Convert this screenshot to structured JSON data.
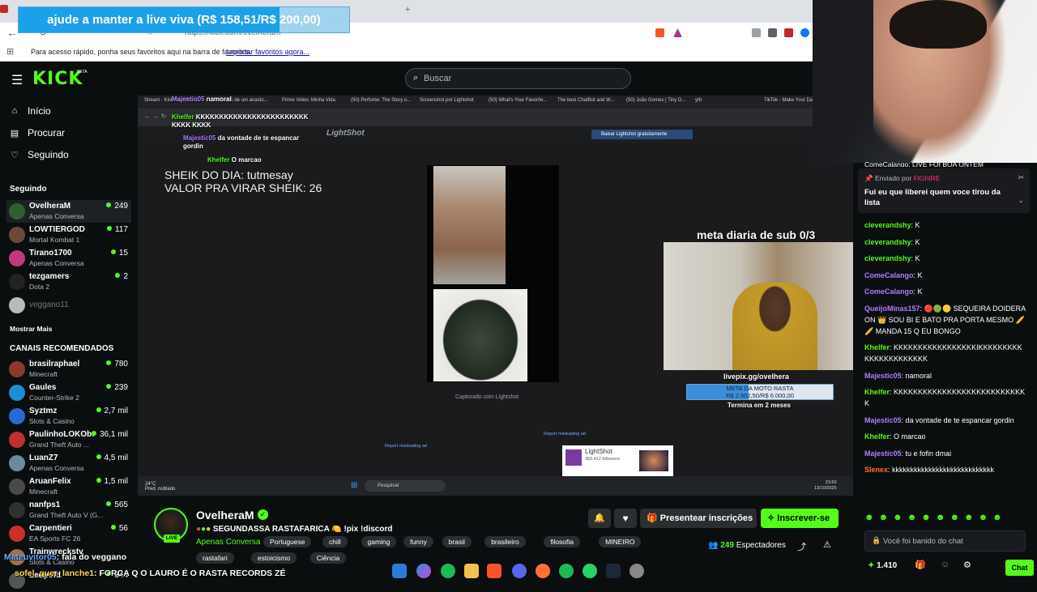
{
  "browser": {
    "donation_text": "ajude a manter a live viva (R$ 158,51/R$ 200,00)",
    "donation_progress": 0.79,
    "url": "https://kick.com/ovelheram",
    "bookmark_hint": "Para acesso rápido, ponha seus favoritos aqui na barra de favoritos.",
    "bookmark_link": "Importar favoritos agora..."
  },
  "header": {
    "logo": "KICK",
    "logo_badge": "BETA",
    "search_placeholder": "Buscar"
  },
  "sidebar": {
    "nav": [
      {
        "label": "Início",
        "icon": "home-icon"
      },
      {
        "label": "Procurar",
        "icon": "browse-icon"
      },
      {
        "label": "Seguindo",
        "icon": "heart-icon"
      }
    ],
    "following_title": "Seguindo",
    "following": [
      {
        "name": "OvelheraM",
        "category": "Apenas Conversa",
        "viewers": "249",
        "color": "#2f5f2f"
      },
      {
        "name": "LOWTIERGOD",
        "category": "Mortal Kombat 1",
        "viewers": "117",
        "color": "#6b4a3a"
      },
      {
        "name": "Tirano1700",
        "category": "Apenas Conversa",
        "viewers": "15",
        "color": "#c0397a"
      },
      {
        "name": "tezgamers",
        "category": "Dota 2",
        "viewers": "2",
        "color": "#222222"
      },
      {
        "name": "veggano11",
        "category": "",
        "viewers": "",
        "color": "#bbbbbb"
      }
    ],
    "show_more": "Mostrar Mais",
    "recommended_title": "CANAIS RECOMENDADOS",
    "recommended": [
      {
        "name": "brasilraphael",
        "category": "Minecraft",
        "viewers": "780",
        "color": "#8a3a2a"
      },
      {
        "name": "Gaules",
        "category": "Counter-Strike 2",
        "viewers": "239",
        "color": "#1b8fd0"
      },
      {
        "name": "Syztmz",
        "category": "Slots & Casino",
        "viewers": "2,7 mil",
        "color": "#2b6ad1"
      },
      {
        "name": "PaulinhoLOKObr",
        "category": "Grand Theft Auto ...",
        "viewers": "36,1 mil",
        "color": "#c03030"
      },
      {
        "name": "LuanZ7",
        "category": "Apenas Conversa",
        "viewers": "4,5 mil",
        "color": "#6a8aa0"
      },
      {
        "name": "AruanFelix",
        "category": "Minecraft",
        "viewers": "1,5 mil",
        "color": "#4a4a4a"
      },
      {
        "name": "nanfps1",
        "category": "Grand Theft Auto V (G...",
        "viewers": "565",
        "color": "#303030"
      },
      {
        "name": "Carpentieri",
        "category": "EA Sports FC 26",
        "viewers": "56",
        "color": "#c8302a"
      },
      {
        "name": "Trainwreckstv",
        "category": "Slots & Casino",
        "viewers": "",
        "color": "#a07050"
      },
      {
        "name": "Leopold",
        "category": "",
        "viewers": "344",
        "color": "#555555"
      }
    ]
  },
  "video": {
    "inner_tabs": [
      "Stream - Kick Dashboard",
      "melhores de um anasto...",
      "Prime Video: Minha Vida",
      "(50) Perfume: The Story o...",
      "Screenshot por Lightshot",
      "(50) What's Your Favorite...",
      "The best ChatBot and W...",
      "(50) João Gomes | Tiny D...",
      "ytb",
      "TikTok - Make Your Day"
    ],
    "lightshot_brand": "LightShot",
    "lightshot_download": "Baixar Lightshot gratuitamente",
    "sheik_text": "SHEIK DO DIA: tutmesay\nVALOR PRA VIRAR SHEIK: 26",
    "captured_text": "Capturado com Lightshot",
    "report_text": "Report misleading ad",
    "sub_goal": "meta diaria de sub 0/3",
    "livepix": "livepix.gg/ovelhera",
    "moto_goal_text": "META DA MOTO RASTA\nR$ 2.502,50/R$ 6.000,00",
    "moto_goal_progress": 0.42,
    "termina": "Termina em 2 meses",
    "lightshot_promo_title": "LightShot",
    "lightshot_promo_followers": "383,412 followers",
    "taskbar_weather": "24°C\nPred. nublado",
    "taskbar_search": "Pesquisar",
    "taskbar_clock": "23:50\n13/10/2025",
    "overlay_chat": [
      {
        "user": "Majestic05",
        "text": "namoral",
        "user_color": "purple"
      },
      {
        "user": "Khelfer",
        "text": "KKKKKKKKKKKKKKKKKKKKKKKK\nKKKK KKKK",
        "user_color": "green"
      },
      {
        "user": "Majestic05",
        "text": "da vontade de te espancar\ngordin",
        "user_color": "purple"
      },
      {
        "user": "Khelfer",
        "text": "O marcao",
        "user_color": "green"
      }
    ]
  },
  "stream": {
    "streamer": "OvelheraM",
    "live_badge": "LIVE",
    "title": "SEGUNDASSA RASTAFARICA 🍋 !pix !discord",
    "category": "Apenas Conversa",
    "tags_row1": [
      "Portuguese",
      "chill",
      "gaming",
      "funny",
      "brasil",
      "brasileiro",
      "filosofia",
      "MINEIRO"
    ],
    "tags_row2": [
      "rastafari",
      "estoicismo",
      "Ciência"
    ],
    "gift_label": "Presentear inscrições",
    "subscribe_label": "Inscrever-se",
    "viewers": "249",
    "viewers_label": "Espectadores"
  },
  "chat": {
    "top_cutoff": "ComeCalango: LIVE FOI BOA ONTEM",
    "pinned_by_label": "Enviado por",
    "pinned_by_user": "FlGhtRE",
    "pinned_message": "Fui eu que liberei quem voce tirou da lista",
    "messages": [
      {
        "user": "cleverandshy",
        "text": "K",
        "color": "#53fc18"
      },
      {
        "user": "cleverandshy",
        "text": "K",
        "color": "#53fc18"
      },
      {
        "user": "cleverandshy",
        "text": "K",
        "color": "#53fc18"
      },
      {
        "user": "ComeCalango",
        "text": "K",
        "color": "#b27cff"
      },
      {
        "user": "ComeCalango",
        "text": "K",
        "color": "#b27cff"
      },
      {
        "user": "QueijoMinas157",
        "text": "🔴🟢🟡 SEQUEIRA DOIDERA ON 👑 SOU BI E BATO PRA PORTA MESMO 🥖🥖 MANDA 15 Q EU BONGO",
        "color": "#b27cff"
      },
      {
        "user": "Khelfer",
        "text": "KKKKKKKKKKKKKKKKKIKKKKKKKKKKKKKKKKKKKKKK",
        "color": "#53fc18"
      },
      {
        "user": "Majestic05",
        "text": "namoral",
        "color": "#b27cff"
      },
      {
        "user": "Khelfer",
        "text": "KKKKKKKKKKKKKKKKKKKKKKKKKKKK",
        "color": "#53fc18"
      },
      {
        "user": "Majestic05",
        "text": "da vontade de te espancar gordin",
        "color": "#b27cff"
      },
      {
        "user": "Khelfer",
        "text": "O marcao",
        "color": "#53fc18"
      },
      {
        "user": "Majestic05",
        "text": "tu e fofin dmai",
        "color": "#b27cff"
      },
      {
        "user": "Slenex",
        "text": "kkkkkkkkkkkkkkkkkkkkkkkkkkkk",
        "color": "#ff6f3a"
      }
    ],
    "input_placeholder": "Você foi banido do chat",
    "points": "1.410",
    "chat_button": "Chat"
  },
  "overlays": {
    "line1_user": "Mateuvitor05",
    "line1_text": ": fala do veggano",
    "line2_user": "sofel_quer_lanche1",
    "line2_text": ": FORCA Q O LAURO É O RASTA RECORDS ZÉ"
  }
}
